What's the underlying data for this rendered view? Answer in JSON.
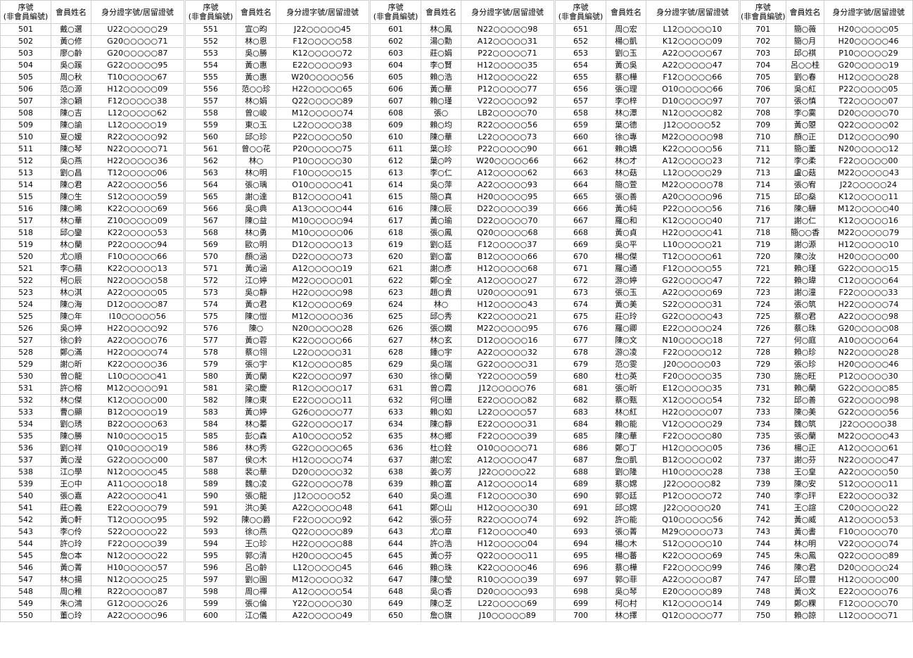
{
  "headers": {
    "seq": "序號\n(非會員編號)",
    "name": "會員姓名",
    "id": "身分證字號/居留證號"
  },
  "blocks": [
    [
      [
        "501",
        "戴○選",
        "U22○○○○○29"
      ],
      [
        "502",
        "黃○修",
        "G20○○○○○71"
      ],
      [
        "503",
        "廖○齡",
        "G20○○○○○87"
      ],
      [
        "504",
        "吳○蹊",
        "G22○○○○○95"
      ],
      [
        "505",
        "周○秋",
        "T10○○○○○67"
      ],
      [
        "506",
        "范○源",
        "H12○○○○○09"
      ],
      [
        "507",
        "涂○穎",
        "F12○○○○○38"
      ],
      [
        "508",
        "陳○吉",
        "L12○○○○○62"
      ],
      [
        "509",
        "陳○諭",
        "L12○○○○○19"
      ],
      [
        "510",
        "夏○媛",
        "R22○○○○○92"
      ],
      [
        "511",
        "陳○琴",
        "N22○○○○○71"
      ],
      [
        "512",
        "吳○燕",
        "H22○○○○○36"
      ],
      [
        "513",
        "劉○昌",
        "T12○○○○○06"
      ],
      [
        "514",
        "陳○君",
        "A22○○○○○56"
      ],
      [
        "515",
        "陳○生",
        "S12○○○○○59"
      ],
      [
        "516",
        "陳○晞",
        "K22○○○○○69"
      ],
      [
        "517",
        "林○華",
        "Z10○○○○○09"
      ],
      [
        "518",
        "邱○鑾",
        "K22○○○○○53"
      ],
      [
        "519",
        "林○蘭",
        "P22○○○○○94"
      ],
      [
        "520",
        "尤○順",
        "F10○○○○○66"
      ],
      [
        "521",
        "李○蘋",
        "K22○○○○○13"
      ],
      [
        "522",
        "柯○辰",
        "N22○○○○○58"
      ],
      [
        "523",
        "林○淇",
        "A22○○○○○05"
      ],
      [
        "524",
        "陳○海",
        "D12○○○○○87"
      ],
      [
        "525",
        "陳○年",
        "I10○○○○○56"
      ],
      [
        "526",
        "吳○婷",
        "H22○○○○○92"
      ],
      [
        "527",
        "徐○鈴",
        "A22○○○○○76"
      ],
      [
        "528",
        "鄭○滿",
        "H22○○○○○74"
      ],
      [
        "529",
        "謝○昕",
        "K22○○○○○36"
      ],
      [
        "530",
        "曾○龍",
        "L10○○○○○41"
      ],
      [
        "531",
        "許○榕",
        "M12○○○○○91"
      ],
      [
        "532",
        "林○傑",
        "K12○○○○○00"
      ],
      [
        "533",
        "曹○顯",
        "B12○○○○○19"
      ],
      [
        "534",
        "劉○琇",
        "B22○○○○○63"
      ],
      [
        "535",
        "陳○勝",
        "N10○○○○○15"
      ],
      [
        "536",
        "劉○祥",
        "Q10○○○○○19"
      ],
      [
        "537",
        "黃○瀅",
        "G22○○○○○00"
      ],
      [
        "538",
        "江○學",
        "N12○○○○○45"
      ],
      [
        "539",
        "王○中",
        "A11○○○○○18"
      ],
      [
        "540",
        "張○嘉",
        "A22○○○○○41"
      ],
      [
        "541",
        "莊○義",
        "E22○○○○○79"
      ],
      [
        "542",
        "黃○軒",
        "T12○○○○○95"
      ],
      [
        "543",
        "李○伶",
        "S22○○○○○22"
      ],
      [
        "544",
        "許○玲",
        "F22○○○○○39"
      ],
      [
        "545",
        "詹○本",
        "N12○○○○○22"
      ],
      [
        "546",
        "黃○菁",
        "H10○○○○○57"
      ],
      [
        "547",
        "林○揚",
        "N12○○○○○25"
      ],
      [
        "548",
        "周○稚",
        "R22○○○○○87"
      ],
      [
        "549",
        "朱○鴻",
        "G12○○○○○26"
      ],
      [
        "550",
        "董○玲",
        "A22○○○○○96"
      ]
    ],
    [
      [
        "551",
        "宣○昀",
        "J22○○○○○45"
      ],
      [
        "552",
        "林○恩",
        "F12○○○○○58"
      ],
      [
        "553",
        "吳○勝",
        "K12○○○○○72"
      ],
      [
        "554",
        "黃○惠",
        "E22○○○○○93"
      ],
      [
        "555",
        "黃○惠",
        "W20○○○○○56"
      ],
      [
        "556",
        "范○○珍",
        "H22○○○○○65"
      ],
      [
        "557",
        "林○娟",
        "Q22○○○○○89"
      ],
      [
        "558",
        "曾○峻",
        "M12○○○○○74"
      ],
      [
        "559",
        "東○玉",
        "L22○○○○○38"
      ],
      [
        "560",
        "邱○珍",
        "P22○○○○○50"
      ],
      [
        "561",
        "曾○○花",
        "P20○○○○○75"
      ],
      [
        "562",
        "林○",
        "P10○○○○○30"
      ],
      [
        "563",
        "林○明",
        "F10○○○○○15"
      ],
      [
        "564",
        "張○瑀",
        "O10○○○○○41"
      ],
      [
        "565",
        "謝○達",
        "B12○○○○○41"
      ],
      [
        "566",
        "吳○典",
        "A13○○○○○44"
      ],
      [
        "567",
        "陳○益",
        "M10○○○○○94"
      ],
      [
        "568",
        "林○勇",
        "M10○○○○○06"
      ],
      [
        "569",
        "歐○明",
        "D12○○○○○13"
      ],
      [
        "570",
        "顏○涵",
        "D22○○○○○73"
      ],
      [
        "571",
        "黃○涵",
        "A12○○○○○19"
      ],
      [
        "572",
        "江○婷",
        "M22○○○○○01"
      ],
      [
        "573",
        "吳○靜",
        "H22○○○○○98"
      ],
      [
        "574",
        "黃○君",
        "K12○○○○○69"
      ],
      [
        "575",
        "陳○愷",
        "M12○○○○○36"
      ],
      [
        "576",
        "陳○",
        "N20○○○○○28"
      ],
      [
        "577",
        "黃○蓉",
        "K22○○○○○66"
      ],
      [
        "578",
        "蔡○翎",
        "L22○○○○○31"
      ],
      [
        "579",
        "張○宇",
        "K12○○○○○85"
      ],
      [
        "580",
        "黃○蘭",
        "K22○○○○○97"
      ],
      [
        "581",
        "梁○慶",
        "R12○○○○○17"
      ],
      [
        "582",
        "陳○東",
        "E22○○○○○11"
      ],
      [
        "583",
        "黃○婷",
        "G26○○○○○77"
      ],
      [
        "584",
        "林○蓁",
        "G22○○○○○17"
      ],
      [
        "585",
        "彭○森",
        "A10○○○○○52"
      ],
      [
        "586",
        "林○秀",
        "G22○○○○○65"
      ],
      [
        "587",
        "侯○木",
        "H12○○○○○74"
      ],
      [
        "588",
        "裴○華",
        "D20○○○○○32"
      ],
      [
        "589",
        "魏○凌",
        "G22○○○○○78"
      ],
      [
        "590",
        "張○龍",
        "J12○○○○○52"
      ],
      [
        "591",
        "洪○美",
        "A22○○○○○48"
      ],
      [
        "592",
        "陳○○爵",
        "F22○○○○○92"
      ],
      [
        "593",
        "徐○燕",
        "Q22○○○○○89"
      ],
      [
        "594",
        "王○珍",
        "H22○○○○○88"
      ],
      [
        "595",
        "郭○清",
        "H20○○○○○45"
      ],
      [
        "596",
        "呂○齡",
        "L12○○○○○45"
      ],
      [
        "597",
        "劉○園",
        "M12○○○○○32"
      ],
      [
        "598",
        "周○禪",
        "A12○○○○○54"
      ],
      [
        "599",
        "張○倫",
        "Y22○○○○○30"
      ],
      [
        "600",
        "江○儀",
        "A22○○○○○49"
      ]
    ],
    [
      [
        "601",
        "林○鳳",
        "N22○○○○○98"
      ],
      [
        "602",
        "湯○勳",
        "A12○○○○○31"
      ],
      [
        "603",
        "莊○娟",
        "P22○○○○○71"
      ],
      [
        "604",
        "李○賢",
        "H12○○○○○35"
      ],
      [
        "605",
        "賴○浩",
        "H12○○○○○22"
      ],
      [
        "606",
        "黃○華",
        "P12○○○○○77"
      ],
      [
        "607",
        "賴○瑾",
        "V22○○○○○92"
      ],
      [
        "608",
        "張○",
        "LB2○○○○○70"
      ],
      [
        "609",
        "賴○均",
        "R22○○○○○56"
      ],
      [
        "610",
        "陳○華",
        "L22○○○○○73"
      ],
      [
        "611",
        "葉○珍",
        "P22○○○○○90"
      ],
      [
        "612",
        "葉○吟",
        "W20○○○○○66"
      ],
      [
        "613",
        "李○仁",
        "A12○○○○○62"
      ],
      [
        "614",
        "吳○萍",
        "A22○○○○○93"
      ],
      [
        "615",
        "簡○真",
        "H20○○○○○95"
      ],
      [
        "616",
        "陳○辰",
        "D22○○○○○39"
      ],
      [
        "617",
        "黃○瑜",
        "D22○○○○○70"
      ],
      [
        "618",
        "張○鳳",
        "Q20○○○○○68"
      ],
      [
        "619",
        "劉○廷",
        "F12○○○○○37"
      ],
      [
        "620",
        "劉○富",
        "B12○○○○○66"
      ],
      [
        "621",
        "謝○彥",
        "H12○○○○○68"
      ],
      [
        "622",
        "鄭○全",
        "A12○○○○○27"
      ],
      [
        "623",
        "趙○貴",
        "U20○○○○○91"
      ],
      [
        "624",
        "林○",
        "H12○○○○○43"
      ],
      [
        "625",
        "邱○秀",
        "K22○○○○○21"
      ],
      [
        "626",
        "張○嫻",
        "M22○○○○○95"
      ],
      [
        "627",
        "林○玄",
        "D12○○○○○16"
      ],
      [
        "628",
        "鍾○宇",
        "A22○○○○○32"
      ],
      [
        "629",
        "吳○瑞",
        "G22○○○○○31"
      ],
      [
        "630",
        "徐○蘭",
        "Y22○○○○○59"
      ],
      [
        "631",
        "曾○霞",
        "J12○○○○○76"
      ],
      [
        "632",
        "何○珊",
        "E22○○○○○82"
      ],
      [
        "633",
        "賴○如",
        "L22○○○○○57"
      ],
      [
        "634",
        "陳○靜",
        "E22○○○○○31"
      ],
      [
        "635",
        "林○鄉",
        "F22○○○○○39"
      ],
      [
        "636",
        "杜○銓",
        "O10○○○○○71"
      ],
      [
        "637",
        "謝○宏",
        "A12○○○○○47"
      ],
      [
        "638",
        "姜○芳",
        "J22○○○○○22"
      ],
      [
        "639",
        "賴○富",
        "A12○○○○○14"
      ],
      [
        "640",
        "吳○進",
        "F12○○○○○30"
      ],
      [
        "641",
        "鄭○山",
        "H12○○○○○30"
      ],
      [
        "642",
        "張○芬",
        "R22○○○○○74"
      ],
      [
        "643",
        "尤○章",
        "F12○○○○○40"
      ],
      [
        "644",
        "許○浩",
        "H12○○○○○04"
      ],
      [
        "645",
        "黃○芬",
        "Q22○○○○○11"
      ],
      [
        "646",
        "賴○珠",
        "K22○○○○○46"
      ],
      [
        "647",
        "陳○瑩",
        "R10○○○○○39"
      ],
      [
        "648",
        "吳○香",
        "D20○○○○○93"
      ],
      [
        "649",
        "陳○芝",
        "L22○○○○○69"
      ],
      [
        "650",
        "詹○旗",
        "J10○○○○○89"
      ]
    ],
    [
      [
        "651",
        "周○宏",
        "L12○○○○○10"
      ],
      [
        "652",
        "楊○凱",
        "K12○○○○○09"
      ],
      [
        "653",
        "劉○玉",
        "A22○○○○○67"
      ],
      [
        "654",
        "黃○吳",
        "A22○○○○○47"
      ],
      [
        "655",
        "蔡○樺",
        "F12○○○○○66"
      ],
      [
        "656",
        "張○理",
        "O10○○○○○66"
      ],
      [
        "657",
        "李○梓",
        "D10○○○○○97"
      ],
      [
        "658",
        "林○潭",
        "N12○○○○○82"
      ],
      [
        "659",
        "葉○德",
        "J12○○○○○52"
      ],
      [
        "660",
        "徐○專",
        "M22○○○○○98"
      ],
      [
        "661",
        "賴○嬌",
        "K22○○○○○56"
      ],
      [
        "662",
        "林○才",
        "A12○○○○○23"
      ],
      [
        "663",
        "林○菇",
        "L12○○○○○29"
      ],
      [
        "664",
        "簡○萱",
        "M22○○○○○78"
      ],
      [
        "665",
        "張○善",
        "A20○○○○○96"
      ],
      [
        "666",
        "黃○純",
        "P22○○○○○56"
      ],
      [
        "667",
        "羅○和",
        "K12○○○○○40"
      ],
      [
        "668",
        "黃○貞",
        "H22○○○○○41"
      ],
      [
        "669",
        "吳○平",
        "L10○○○○○21"
      ],
      [
        "670",
        "楊○傑",
        "T12○○○○○61"
      ],
      [
        "671",
        "羅○通",
        "F12○○○○○55"
      ],
      [
        "672",
        "游○婷",
        "G22○○○○○47"
      ],
      [
        "673",
        "張○玉",
        "A22○○○○○69"
      ],
      [
        "674",
        "黃○美",
        "S22○○○○○31"
      ],
      [
        "675",
        "莊○玲",
        "G22○○○○○43"
      ],
      [
        "676",
        "羅○卿",
        "E22○○○○○24"
      ],
      [
        "677",
        "陳○文",
        "N10○○○○○18"
      ],
      [
        "678",
        "游○凌",
        "F22○○○○○12"
      ],
      [
        "679",
        "范○雯",
        "J20○○○○○03"
      ],
      [
        "680",
        "杜○英",
        "F20○○○○○35"
      ],
      [
        "681",
        "張○昕",
        "E12○○○○○35"
      ],
      [
        "682",
        "蔡○甄",
        "X12○○○○○54"
      ],
      [
        "683",
        "林○紅",
        "H22○○○○○07"
      ],
      [
        "684",
        "賴○能",
        "V12○○○○○29"
      ],
      [
        "685",
        "陳○華",
        "F22○○○○○80"
      ],
      [
        "686",
        "鄭○丁",
        "H12○○○○○05"
      ],
      [
        "687",
        "詹○凱",
        "B12○○○○○02"
      ],
      [
        "688",
        "劉○隆",
        "H10○○○○○28"
      ],
      [
        "689",
        "蔡○嫦",
        "J22○○○○○82"
      ],
      [
        "690",
        "郭○廷",
        "P12○○○○○72"
      ],
      [
        "691",
        "邱○嫦",
        "J22○○○○○20"
      ],
      [
        "692",
        "許○能",
        "Q10○○○○○56"
      ],
      [
        "693",
        "張○菁",
        "M29○○○○○73"
      ],
      [
        "694",
        "楊○木",
        "S12○○○○○10"
      ],
      [
        "695",
        "楊○蕃",
        "K22○○○○○69"
      ],
      [
        "696",
        "蔡○樺",
        "F22○○○○○99"
      ],
      [
        "697",
        "郭○菲",
        "A22○○○○○87"
      ],
      [
        "698",
        "吳○琴",
        "E20○○○○○89"
      ],
      [
        "699",
        "柯○村",
        "K12○○○○○14"
      ],
      [
        "700",
        "林○擇",
        "Q12○○○○○77"
      ]
    ],
    [
      [
        "701",
        "簡○薇",
        "H20○○○○○05"
      ],
      [
        "702",
        "簡○月",
        "H20○○○○○46"
      ],
      [
        "703",
        "邱○祺",
        "P10○○○○○29"
      ],
      [
        "704",
        "呂○○桂",
        "G20○○○○○19"
      ],
      [
        "705",
        "劉○春",
        "H12○○○○○28"
      ],
      [
        "706",
        "吳○紅",
        "P22○○○○○05"
      ],
      [
        "707",
        "張○慎",
        "T22○○○○○07"
      ],
      [
        "708",
        "李○霙",
        "D20○○○○○70"
      ],
      [
        "709",
        "黃○曌",
        "Q22○○○○○02"
      ],
      [
        "710",
        "顏○正",
        "D12○○○○○90"
      ],
      [
        "711",
        "簡○董",
        "N20○○○○○12"
      ],
      [
        "712",
        "李○柔",
        "F22○○○○○00"
      ],
      [
        "713",
        "盧○菇",
        "M22○○○○○43"
      ],
      [
        "714",
        "張○宥",
        "J22○○○○○24"
      ],
      [
        "715",
        "邱○燊",
        "K12○○○○○11"
      ],
      [
        "716",
        "陳○驊",
        "M12○○○○○40"
      ],
      [
        "717",
        "謝○仁",
        "K12○○○○○16"
      ],
      [
        "718",
        "簡○○香",
        "M22○○○○○79"
      ],
      [
        "719",
        "謝○源",
        "H12○○○○○10"
      ],
      [
        "720",
        "陳○汝",
        "H20○○○○○00"
      ],
      [
        "721",
        "賴○瑾",
        "G22○○○○○15"
      ],
      [
        "722",
        "賴○瑋",
        "C12○○○○○64"
      ],
      [
        "723",
        "謝○潼",
        "F22○○○○○33"
      ],
      [
        "724",
        "張○筑",
        "H22○○○○○74"
      ],
      [
        "725",
        "蔡○君",
        "A22○○○○○98"
      ],
      [
        "726",
        "蔡○珠",
        "G20○○○○○08"
      ],
      [
        "727",
        "何○庭",
        "A10○○○○○64"
      ],
      [
        "728",
        "賴○珍",
        "N22○○○○○28"
      ],
      [
        "729",
        "張○珍",
        "H20○○○○○46"
      ],
      [
        "730",
        "施○旺",
        "P12○○○○○30"
      ],
      [
        "731",
        "賴○蘭",
        "G22○○○○○85"
      ],
      [
        "732",
        "邱○善",
        "G22○○○○○98"
      ],
      [
        "733",
        "陳○美",
        "G22○○○○○56"
      ],
      [
        "734",
        "魏○筑",
        "J22○○○○○38"
      ],
      [
        "735",
        "張○蘭",
        "M22○○○○○43"
      ],
      [
        "736",
        "楊○正",
        "A12○○○○○61"
      ],
      [
        "737",
        "謝○芬",
        "N22○○○○○47"
      ],
      [
        "738",
        "王○皇",
        "A22○○○○○50"
      ],
      [
        "739",
        "陳○安",
        "S12○○○○○11"
      ],
      [
        "740",
        "李○玶",
        "E22○○○○○32"
      ],
      [
        "741",
        "王○諠",
        "C20○○○○○22"
      ],
      [
        "742",
        "黃○威",
        "A12○○○○○53"
      ],
      [
        "743",
        "黃○書",
        "F10○○○○○70"
      ],
      [
        "744",
        "林○明",
        "V22○○○○○74"
      ],
      [
        "745",
        "朱○鳳",
        "Q22○○○○○89"
      ],
      [
        "746",
        "陳○君",
        "D20○○○○○24"
      ],
      [
        "747",
        "邱○豐",
        "H12○○○○○00"
      ],
      [
        "748",
        "黃○文",
        "E22○○○○○76"
      ],
      [
        "749",
        "鄭○粿",
        "F12○○○○○70"
      ],
      [
        "750",
        "賴○諒",
        "L12○○○○○71"
      ]
    ]
  ]
}
